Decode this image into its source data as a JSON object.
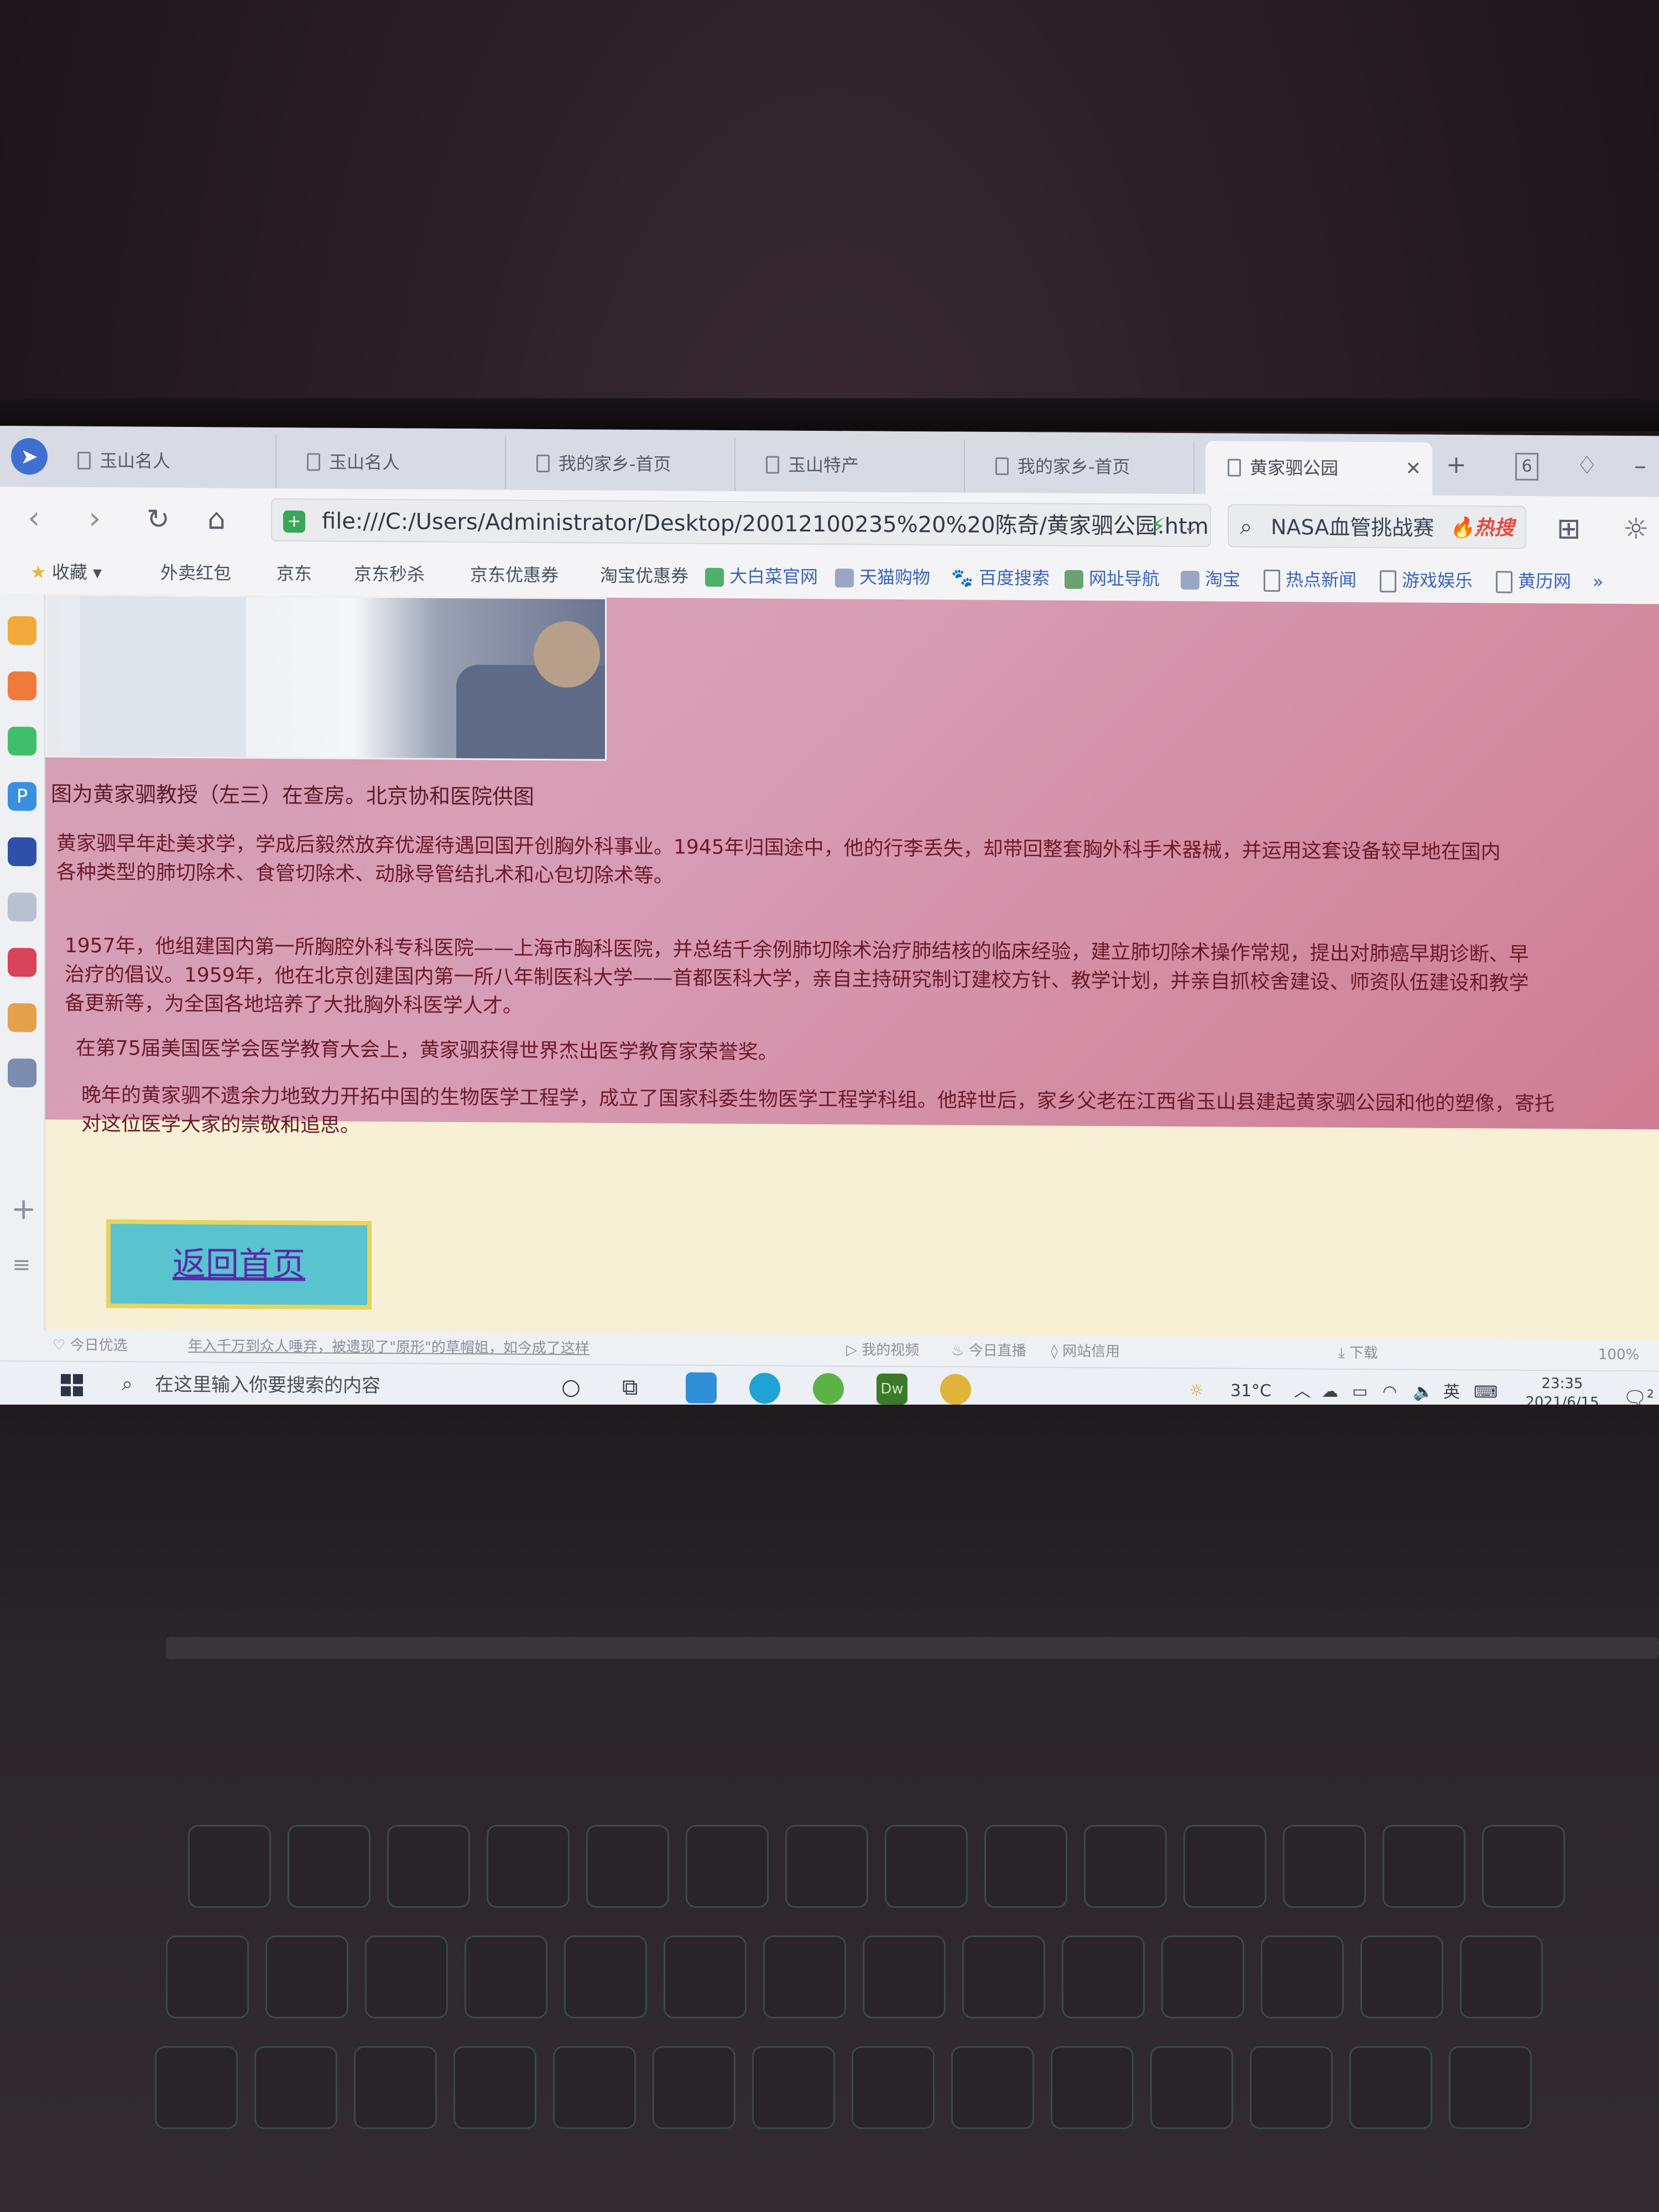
{
  "browser": {
    "tabs": [
      {
        "label": "玉山名人"
      },
      {
        "label": "玉山名人"
      },
      {
        "label": "我的家乡-首页"
      },
      {
        "label": "玉山特产"
      },
      {
        "label": "我的家乡-首页"
      },
      {
        "label": "黄家驷公园",
        "active": true
      }
    ],
    "tab_count": "6",
    "url": "file:///C:/Users/Administrator/Desktop/20012100235%20%20陈奇/黄家驷公园.html",
    "search_text": "NASA血管挑战赛",
    "search_hot": "热搜",
    "bookmarks": [
      "收藏",
      "外卖红包",
      "京东",
      "京东秒杀",
      "京东优惠券",
      "淘宝优惠券",
      "大白菜官网",
      "天猫购物",
      "百度搜索",
      "网址导航",
      "淘宝",
      "热点新闻",
      "游戏娱乐",
      "黄历网"
    ],
    "bookmarks_more": "»"
  },
  "page": {
    "caption": "图为黄家驷教授（左三）在查房。北京协和医院供图",
    "paragraphs": [
      [
        "黄家驷早年赴美求学，学成后毅然放弃优渥待遇回国开创胸外科事业。1945年归国途中，他的行李丢失，却带回整套胸外科手术器械，并运用这套设备较早地在国内",
        "各种类型的肺切除术、食管切除术、动脉导管结扎术和心包切除术等。"
      ],
      [
        "1957年，他组建国内第一所胸腔外科专科医院——上海市胸科医院，并总结千余例肺切除术治疗肺结核的临床经验，建立肺切除术操作常规，提出对肺癌早期诊断、早",
        "治疗的倡议。1959年，他在北京创建国内第一所八年制医科大学——首都医科大学，亲自主持研究制订建校方针、教学计划，并亲自抓校舍建设、师资队伍建设和教学",
        "备更新等，为全国各地培养了大批胸外科医学人才。"
      ],
      [
        "在第75届美国医学会医学教育大会上，黄家驷获得世界杰出医学教育家荣誉奖。"
      ],
      [
        "晚年的黄家驷不遗余力地致力开拓中国的生物医学工程学，成立了国家科委生物医学工程学科组。他辞世后，家乡父老在江西省玉山县建起黄家驷公园和他的塑像，寄托",
        "对这位医学大家的崇敬和追思。"
      ]
    ],
    "back_button": "返回首页"
  },
  "statusbar": {
    "left_label": "今日优选",
    "news": "年入千万到众人唾弃，被遗现了\"原形\"的草帽姐，如今成了这样",
    "items": [
      "我的视频",
      "今日直播",
      "网站信用",
      "下载",
      "100%"
    ]
  },
  "taskbar": {
    "search_placeholder": "在这里输入你要搜索的内容",
    "weather": "31°C",
    "ime": "英",
    "time": "23:35",
    "date": "2021/6/15",
    "notif_count": "2",
    "dw_label": "Dw"
  },
  "colors": {
    "page_pink": "#d6a0b4",
    "page_cream": "#f7f0d4",
    "button_bg": "#59c3cf",
    "button_border": "#e7d45e",
    "text_maroon": "#6a1a2c"
  }
}
